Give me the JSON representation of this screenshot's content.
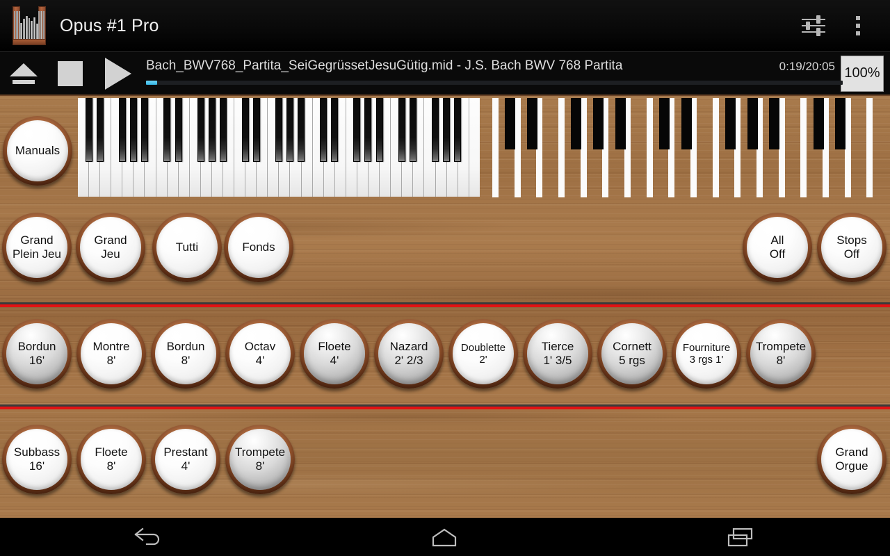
{
  "app": {
    "title": "Opus #1 Pro",
    "icon": "organ-pipes-icon",
    "actions": [
      {
        "name": "equalizer-sliders-icon",
        "label": "Settings"
      },
      {
        "name": "overflow-menu-icon",
        "label": "More options"
      }
    ]
  },
  "player": {
    "eject_label": "Eject",
    "stop_label": "Stop",
    "play_label": "Play",
    "track_title": "Bach_BWV768_Partita_SeiGegrüssetJesuGütig.mid - J.S. Bach BWV 768 Partita",
    "time": "0:19/20:05",
    "elapsed": "0:19",
    "duration": "20:05",
    "progress_percent": 1.6,
    "progress_color": "#33b5e5",
    "tempo_label": "100%"
  },
  "console": {
    "wood_color": "#a87a4c",
    "divider_color": "#e21212",
    "manuals_button": {
      "label": "Manuals",
      "state": "off"
    },
    "keyboard": {
      "name": "manual-keyboard",
      "white_keys": 36,
      "octaves": 5
    },
    "pedalboard": {
      "name": "pedalboard",
      "white_keys": 18
    }
  },
  "combinations": {
    "left": [
      {
        "label": "Grand\nPlein Jeu",
        "line1": "Grand",
        "line2": "Plein Jeu",
        "state": "off"
      },
      {
        "label": "Grand Jeu",
        "line1": "Grand",
        "line2": "Jeu",
        "state": "off"
      },
      {
        "label": "Tutti",
        "line1": "Tutti",
        "line2": "",
        "state": "off"
      },
      {
        "label": "Fonds",
        "line1": "Fonds",
        "line2": "",
        "state": "off"
      }
    ],
    "right": [
      {
        "label": "All Off",
        "line1": "All",
        "line2": "Off",
        "state": "off"
      },
      {
        "label": "Stops Off",
        "line1": "Stops",
        "line2": "Off",
        "state": "off"
      }
    ]
  },
  "manual_stops": [
    {
      "name": "Bordun",
      "pitch": "16'",
      "state": "on"
    },
    {
      "name": "Montre",
      "pitch": "8'",
      "state": "off"
    },
    {
      "name": "Bordun",
      "pitch": "8'",
      "state": "off"
    },
    {
      "name": "Octav",
      "pitch": "4'",
      "state": "off"
    },
    {
      "name": "Floete",
      "pitch": "4'",
      "state": "on"
    },
    {
      "name": "Nazard",
      "pitch": "2' 2/3",
      "state": "on"
    },
    {
      "name": "Doublette",
      "pitch": "2'",
      "state": "off"
    },
    {
      "name": "Tierce",
      "pitch": "1' 3/5",
      "state": "on"
    },
    {
      "name": "Cornett",
      "pitch": "5 rgs",
      "state": "on"
    },
    {
      "name": "Fourniture",
      "pitch": "3 rgs 1'",
      "state": "off"
    },
    {
      "name": "Trompete",
      "pitch": "8'",
      "state": "on"
    }
  ],
  "pedal_stops": [
    {
      "name": "Subbass",
      "pitch": "16'",
      "state": "off"
    },
    {
      "name": "Floete",
      "pitch": "8'",
      "state": "off"
    },
    {
      "name": "Prestant",
      "pitch": "4'",
      "state": "off"
    },
    {
      "name": "Trompete",
      "pitch": "8'",
      "state": "on"
    }
  ],
  "pedal_coupler": {
    "line1": "Grand",
    "line2": "Orgue",
    "label": "Grand Orgue",
    "state": "off"
  },
  "navbar": {
    "back": "back-icon",
    "home": "home-icon",
    "recents": "recents-icon"
  }
}
